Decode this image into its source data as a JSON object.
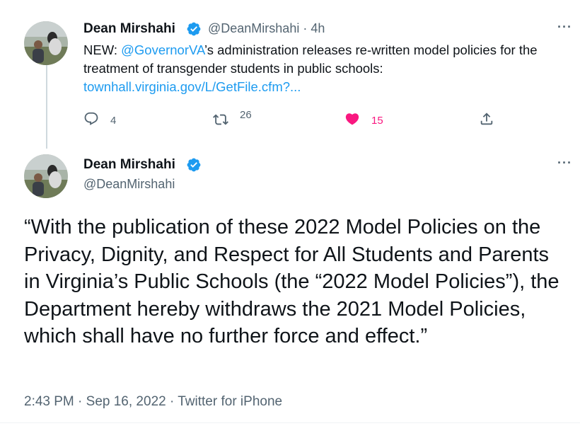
{
  "first_tweet": {
    "author_name": "Dean Mirshahi",
    "handle": "@DeanMirshahi",
    "separator": "·",
    "time_ago": "4h",
    "text_prefix": "NEW: ",
    "mention": "@GovernorVA",
    "text_body": "’s administration releases re-written model policies for the treatment of transgender students in public schools:",
    "link": "townhall.virginia.gov/L/GetFile.cfm?...",
    "reply_count": "4",
    "retweet_count": "26",
    "like_count": "15",
    "liked": true,
    "accent_color": "#1d9bf0",
    "like_color": "#f91880"
  },
  "main_tweet": {
    "author_name": "Dean Mirshahi",
    "handle": "@DeanMirshahi",
    "text": "“With the publication of these 2022 Model Policies on the Privacy, Dignity, and Respect for All Students and Parents in Virginia’s Public Schools (the “2022 Model Policies”), the Department hereby withdraws the 2021 Model Policies, which shall have no further force and effect.”",
    "time": "2:43 PM",
    "date": "Sep 16, 2022",
    "source": "Twitter for iPhone",
    "meta_separator": "·"
  },
  "icons": {
    "verified": "verified-badge-icon",
    "more": "more-options-icon",
    "reply": "reply-icon",
    "retweet": "retweet-icon",
    "like": "heart-icon",
    "share": "share-icon"
  }
}
